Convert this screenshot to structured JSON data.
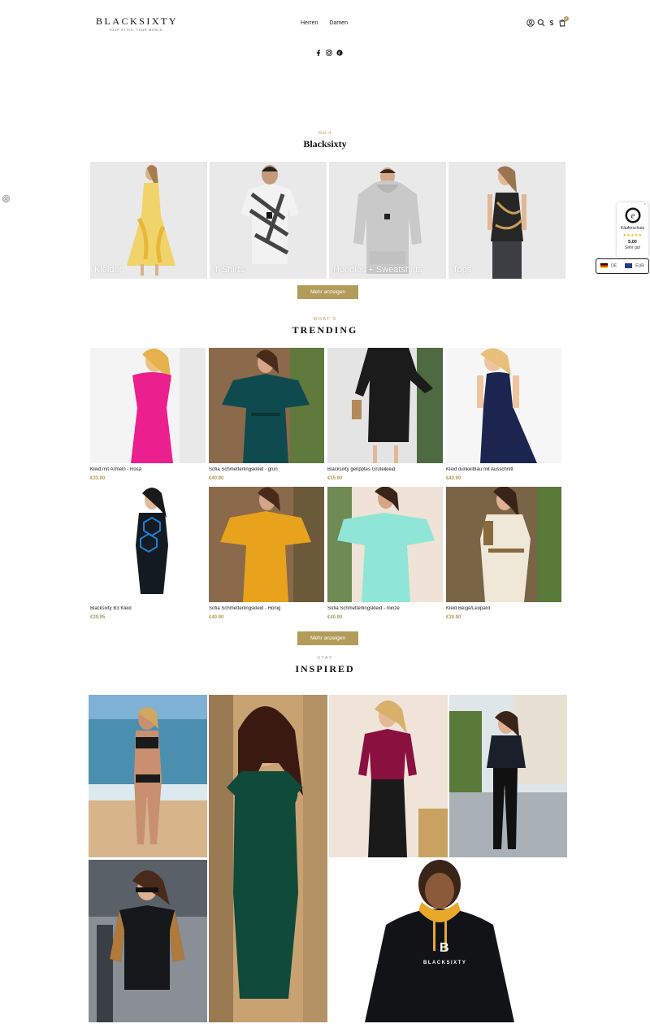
{
  "header": {
    "logo": "BLACKSIXTY",
    "tagline": "YOUR STYLE. YOUR WORLD.",
    "nav": [
      "Herren",
      "Damen"
    ],
    "cart_count": "0"
  },
  "categories_section": {
    "kicker": "Get it",
    "title": "Blacksixty",
    "items": [
      {
        "label": "Kleider"
      },
      {
        "label": "T-Shirts"
      },
      {
        "label": "Hoodies + Sweatshirts"
      },
      {
        "label": "Tops"
      }
    ],
    "more_button": "Mehr anzeigen"
  },
  "trending": {
    "kicker": "WHAT'S",
    "title": "TRENDING",
    "products": [
      {
        "name": "Kleid mit Ärmeln - Rosa",
        "price": "€33.90",
        "color": "#e8209a"
      },
      {
        "name": "Sofia Schmetterlingskleid - grün",
        "price": "€40.90",
        "color": "#0f4a4f"
      },
      {
        "name": "Blacksixty geripptes Grüteikleid",
        "price": "€15.90",
        "color": "#1a1a1a"
      },
      {
        "name": "Kleid dunkelblau mit Ausschnitt",
        "price": "€43.90",
        "color": "#1b2550"
      },
      {
        "name": "Blacksixty B3 Kleid",
        "price": "€39.95",
        "color": "#101820"
      },
      {
        "name": "Sofia Schmetterlingskleid - Honig",
        "price": "€40.90",
        "color": "#e9a21c"
      },
      {
        "name": "Sofia Schmetterlingskleid - minze",
        "price": "€40.90",
        "color": "#8fe6d6"
      },
      {
        "name": "Kleid Beige/Leopard",
        "price": "€39.90",
        "color": "#efe8d8"
      }
    ],
    "more_button": "Mehr anzeigen"
  },
  "inspired": {
    "kicker": "STAY",
    "title": "INSPIRED",
    "hoodie_brand": "BLACKSIXTY",
    "hoodie_letter": "B"
  },
  "trust_badge": {
    "label": "Käuferschutz",
    "stars": "★★★★★",
    "score": "5,00",
    "rating_text": "Sehr gut",
    "close": "×"
  },
  "locale": {
    "language": "DE",
    "currency": "EUR"
  }
}
